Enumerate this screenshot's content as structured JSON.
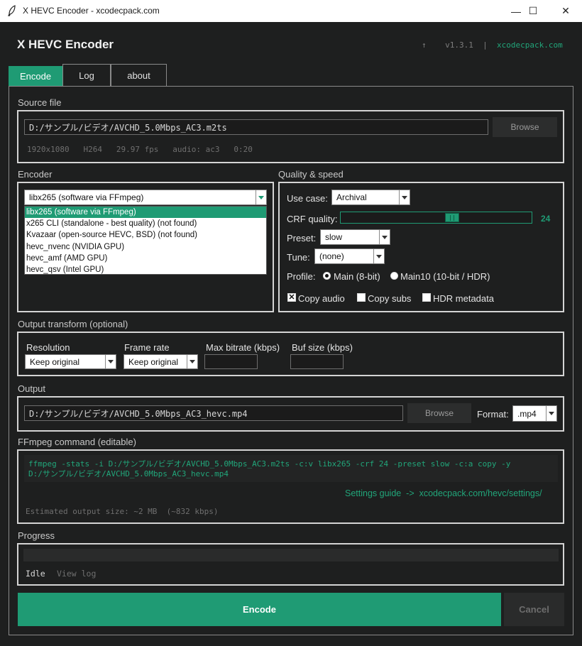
{
  "window": {
    "title": "X HEVC Encoder - xcodecpack.com",
    "minimize_glyph": "—",
    "maximize_glyph": "☐",
    "close_glyph": "✕"
  },
  "header": {
    "app_title": "X HEVC Encoder",
    "arrow": "↑",
    "version": "v1.3.1",
    "separator": "|",
    "site_link": "xcodecpack.com"
  },
  "tabs": [
    {
      "label": "Encode",
      "active": true
    },
    {
      "label": "Log",
      "active": false
    },
    {
      "label": "about",
      "active": false
    }
  ],
  "source": {
    "label": "Source file",
    "path": "D:/サンプル/ビデオ/AVCHD_5.0Mbps_AC3.m2ts",
    "browse_label": "Browse",
    "info": "1920x1080   H264   29.97 fps   audio: ac3   0:20"
  },
  "encoder": {
    "label": "Encoder",
    "selected": "libx265 (software via FFmpeg)",
    "options": [
      "libx265 (software via FFmpeg)",
      "x265 CLI (standalone - best quality)  (not found)",
      "Kvazaar (open-source HEVC, BSD)  (not found)",
      "hevc_nvenc (NVIDIA GPU)",
      "hevc_amf (AMD GPU)",
      "hevc_qsv (Intel GPU)"
    ]
  },
  "quality": {
    "label": "Quality & speed",
    "use_case_label": "Use case:",
    "use_case_value": "Archival",
    "crf_label": "CRF quality:",
    "crf_value": "24",
    "crf_level": 0.59,
    "preset_label": "Preset:",
    "preset_value": "slow",
    "tune_label": "Tune:",
    "tune_value": "(none)",
    "profile_label": "Profile:",
    "profile_main": "Main (8-bit)",
    "profile_main10": "Main10 (10-bit / HDR)",
    "profile_selected": "main",
    "copy_audio_label": "Copy audio",
    "copy_audio_checked": true,
    "copy_subs_label": "Copy subs",
    "copy_subs_checked": false,
    "hdr_label": "HDR metadata",
    "hdr_checked": false
  },
  "transform": {
    "label": "Output transform (optional)",
    "resolution_label": "Resolution",
    "resolution_value": "Keep original",
    "framerate_label": "Frame rate",
    "framerate_value": "Keep original",
    "maxbitrate_label": "Max bitrate (kbps)",
    "maxbitrate_value": "",
    "bufsize_label": "Buf size (kbps)",
    "bufsize_value": ""
  },
  "output": {
    "label": "Output",
    "path": "D:/サンプル/ビデオ/AVCHD_5.0Mbps_AC3_hevc.mp4",
    "browse_label": "Browse",
    "format_label": "Format:",
    "format_value": ".mp4"
  },
  "command": {
    "label": "FFmpeg command (editable)",
    "line1": "ffmpeg -stats -i D:/サンプル/ビデオ/AVCHD_5.0Mbps_AC3.m2ts -c:v libx265 -crf 24 -preset slow -c:a copy -y",
    "line2": "D:/サンプル/ビデオ/AVCHD_5.0Mbps_AC3_hevc.mp4",
    "guide_text": "Settings guide  ->  xcodecpack.com/hevc/settings/",
    "estimate": "Estimated output size: ~2 MB  (~832 kbps)"
  },
  "progress": {
    "label": "Progress",
    "value": 0,
    "status": "Idle",
    "view_log": "View log"
  },
  "actions": {
    "encode_label": "Encode",
    "cancel_label": "Cancel"
  },
  "colors": {
    "accent": "#1f9b74",
    "background": "#1e1f1f"
  }
}
